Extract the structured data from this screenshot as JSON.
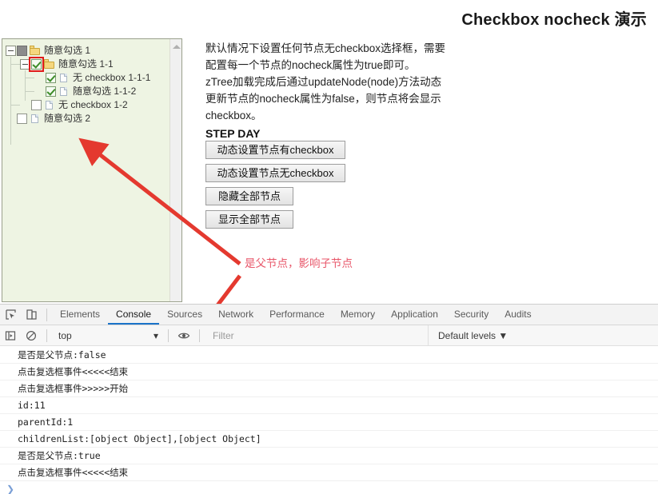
{
  "page": {
    "title": "Checkbox nocheck 演示",
    "description_lines": [
      "默认情况下设置任何节点无checkbox选择框，需要",
      "配置每一个节点的nocheck属性为true即可。",
      "zTree加载完成后通过updateNode(node)方法动态",
      "更新节点的nocheck属性为false，则节点将会显示",
      "checkbox。"
    ],
    "step_heading": "STEP DAY",
    "annotation": "是父节点，影响子节点"
  },
  "buttons": [
    {
      "label": "动态设置节点有checkbox"
    },
    {
      "label": "动态设置节点无checkbox"
    },
    {
      "label": "隐藏全部节点"
    },
    {
      "label": "显示全部节点"
    }
  ],
  "tree": {
    "nodes": [
      {
        "label": "随意勾选 1",
        "switch": "minus",
        "check": "part",
        "icon": "folder",
        "highlight": false,
        "children": [
          {
            "label": "随意勾选 1-1",
            "switch": "minus",
            "check": "on",
            "icon": "folder",
            "highlight": true,
            "children": [
              {
                "label": "无 checkbox 1-1-1",
                "switch": "none",
                "check": "on",
                "icon": "file",
                "highlight": false,
                "children": []
              },
              {
                "label": "随意勾选 1-1-2",
                "switch": "none",
                "check": "on",
                "icon": "file",
                "highlight": false,
                "children": []
              }
            ]
          },
          {
            "label": "无 checkbox 1-2",
            "switch": "none",
            "check": "off",
            "icon": "file",
            "highlight": false,
            "children": []
          }
        ]
      },
      {
        "label": "随意勾选 2",
        "switch": "none",
        "check": "off",
        "icon": "file",
        "highlight": false,
        "children": []
      }
    ]
  },
  "devtools": {
    "tabs": [
      {
        "label": "Elements",
        "active": false
      },
      {
        "label": "Console",
        "active": true
      },
      {
        "label": "Sources",
        "active": false
      },
      {
        "label": "Network",
        "active": false
      },
      {
        "label": "Performance",
        "active": false
      },
      {
        "label": "Memory",
        "active": false
      },
      {
        "label": "Application",
        "active": false
      },
      {
        "label": "Security",
        "active": false
      },
      {
        "label": "Audits",
        "active": false
      }
    ],
    "context": "top",
    "filter_placeholder": "Filter",
    "filter_value": "",
    "levels": "Default levels ▼",
    "prompt": "❯",
    "console_messages": [
      "是否是父节点:false",
      "点击复选框事件<<<<<结束",
      "点击复选框事件>>>>>开始",
      "id:11",
      "parentId:1",
      "childrenList:[object Object],[object Object]",
      "是否是父节点:true",
      "点击复选框事件<<<<<结束"
    ]
  },
  "colors": {
    "accent": "#1a73c9",
    "annotation": "#e8576a",
    "arrow": "#e4392f",
    "tree_bg": "#eef4e3"
  }
}
